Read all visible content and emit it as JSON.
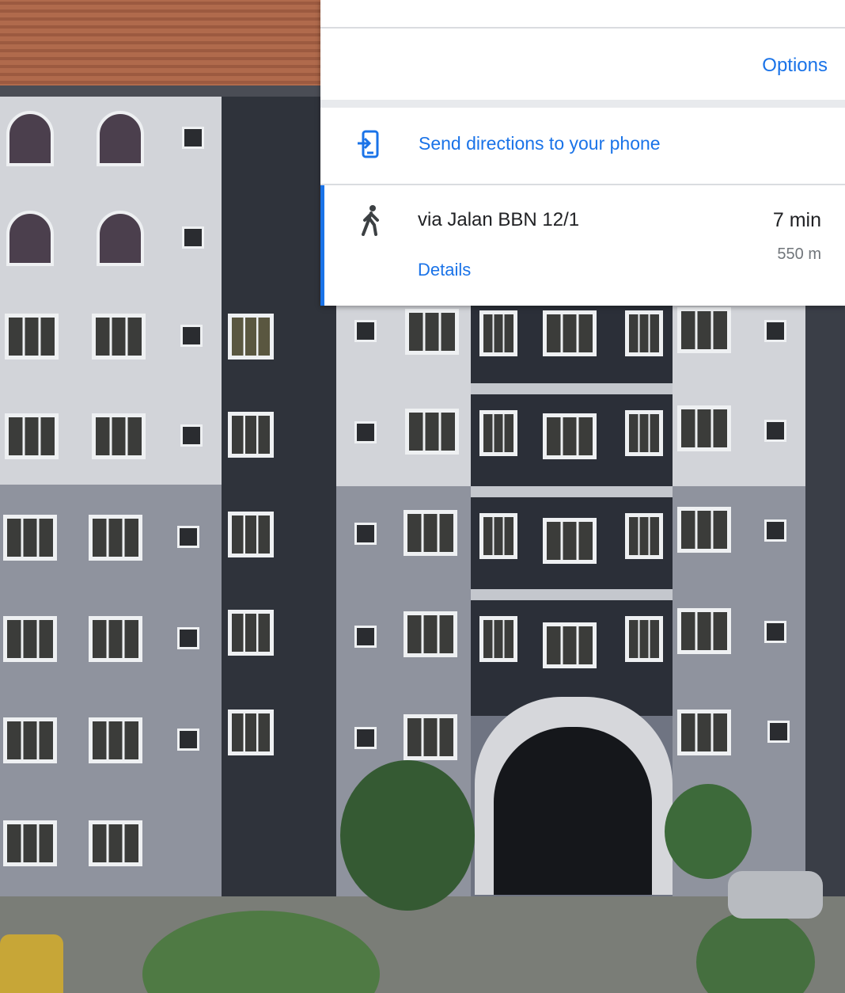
{
  "directions_panel": {
    "options_label": "Options",
    "send_to_phone_label": "Send directions to your phone",
    "send_icon": "send-to-phone-icon",
    "route": {
      "mode_icon": "walking-icon",
      "name": "via Jalan BBN 12/1",
      "duration": "7 min",
      "distance": "550 m",
      "details_label": "Details",
      "selected": true
    }
  },
  "colors": {
    "link": "#1a73e8",
    "primary_text": "#202124",
    "secondary_text": "#70757a",
    "selected_accent": "#1a73e8"
  }
}
